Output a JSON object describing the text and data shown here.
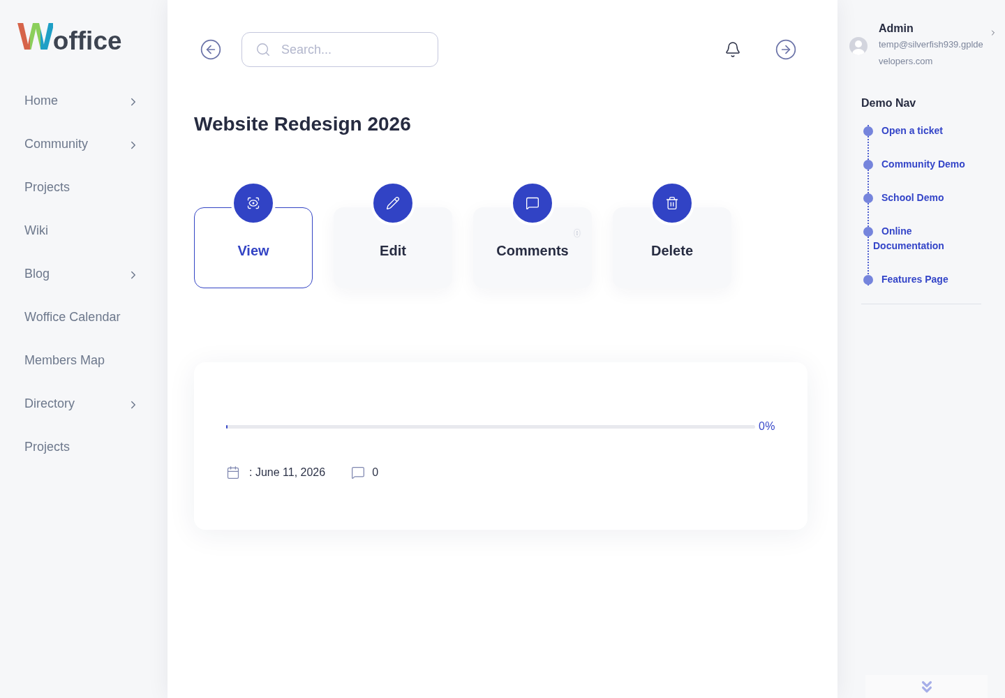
{
  "sidebar": {
    "logo": {
      "initial": "W",
      "rest": "office"
    },
    "items": [
      {
        "label": "Home",
        "has_submenu": true
      },
      {
        "label": "Community",
        "has_submenu": true
      },
      {
        "label": "Projects",
        "has_submenu": false
      },
      {
        "label": "Wiki",
        "has_submenu": false
      },
      {
        "label": "Blog",
        "has_submenu": true
      },
      {
        "label": "Woffice Calendar",
        "has_submenu": false
      },
      {
        "label": "Members Map",
        "has_submenu": false
      },
      {
        "label": "Directory",
        "has_submenu": true
      },
      {
        "label": "Projects",
        "has_submenu": false
      }
    ]
  },
  "topbar": {
    "search": {
      "placeholder": "Search..."
    }
  },
  "project": {
    "title": "Website Redesign 2026",
    "actions": [
      {
        "kind": "view",
        "label": "View",
        "selected": true
      },
      {
        "kind": "edit",
        "label": "Edit",
        "selected": false
      },
      {
        "kind": "comments",
        "label": "Comments",
        "selected": false,
        "badge": "0"
      },
      {
        "kind": "delete",
        "label": "Delete",
        "selected": false
      }
    ],
    "progress": {
      "level": 0,
      "reading": "0%"
    },
    "meta": {
      "date": ": June 11, 2026",
      "comment_count": "0"
    }
  },
  "user_panel": {
    "name": "Admin",
    "email": "temp@silverfish939.gpldevelopers.com"
  },
  "demo_nav": {
    "title": "Demo Nav",
    "items": [
      "Open a ticket",
      "Community Demo",
      "School Demo",
      "Online Documentation",
      "Features Page"
    ]
  }
}
